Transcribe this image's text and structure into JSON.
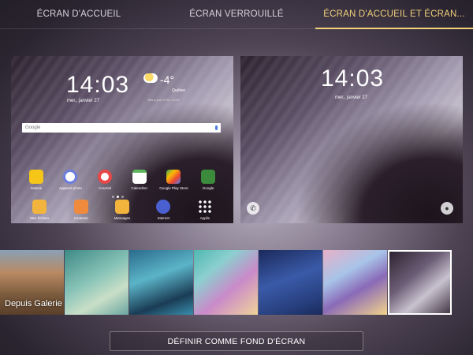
{
  "tabs": [
    {
      "label": "ÉCRAN D'ACCUEIL",
      "active": false
    },
    {
      "label": "ÉCRAN VERROUILLÉ",
      "active": false
    },
    {
      "label": "ÉCRAN D'ACCUEIL ET ÉCRAN...",
      "active": true
    }
  ],
  "home_preview": {
    "time": "14:03",
    "date": "mer., janvier 27",
    "weather": {
      "temp": "-4°",
      "city": "Québec",
      "updated": "Mis à jour 27/01 14:02"
    },
    "search_logo": "Google",
    "apps_row1": [
      {
        "label": "Galerie",
        "color": "#f5c518"
      },
      {
        "label": "Appareil photo",
        "color": "#6b7de0"
      },
      {
        "label": "Courriel",
        "color": "#e84848"
      },
      {
        "label": "Calendrier",
        "color": "#5fb85f"
      },
      {
        "label": "Google Play Store",
        "color": "#e8e8e8"
      },
      {
        "label": "Google",
        "color": "#3c8a3c"
      }
    ],
    "apps_row2": [
      {
        "label": "Mes fichiers",
        "color": "#f2b43c"
      },
      {
        "label": "Contacts",
        "color": "#f08a3c"
      },
      {
        "label": "Messages",
        "color": "#f2b43c"
      },
      {
        "label": "Internet",
        "color": "#4a5fd0"
      },
      {
        "label": "Applis",
        "color": "#f0f0f0"
      }
    ]
  },
  "lock_preview": {
    "time": "14:03",
    "date": "mer., janvier 27",
    "phone_icon": "phone-icon",
    "camera_icon": "camera-icon"
  },
  "wallpapers": [
    {
      "label": "Depuis Galerie",
      "selected": false
    },
    {
      "label": "",
      "selected": false
    },
    {
      "label": "",
      "selected": false
    },
    {
      "label": "",
      "selected": false
    },
    {
      "label": "",
      "selected": false
    },
    {
      "label": "",
      "selected": false
    },
    {
      "label": "",
      "selected": true
    }
  ],
  "set_button": "DÉFINIR COMME FOND D'ÉCRAN",
  "colors": {
    "accent": "#f3d27a"
  }
}
